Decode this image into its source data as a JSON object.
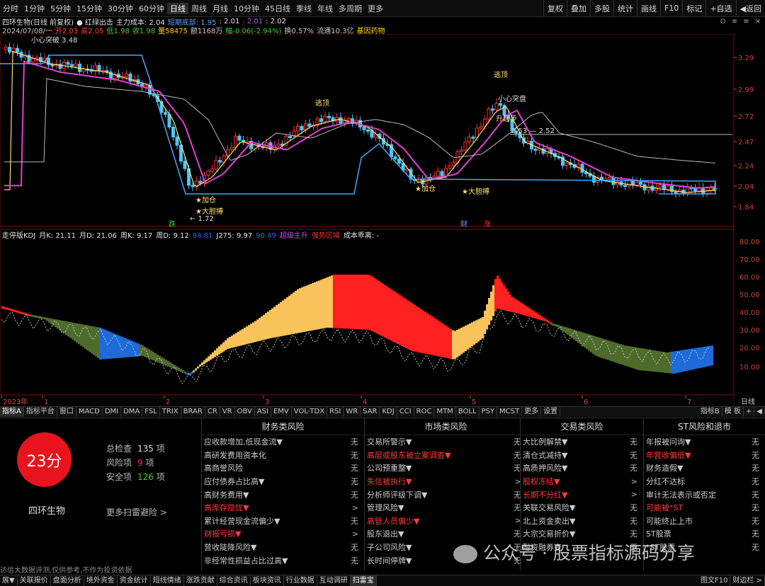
{
  "toolbar": {
    "periods": [
      "分时",
      "1分钟",
      "5分钟",
      "15分钟",
      "30分钟",
      "60分钟",
      "日线",
      "周线",
      "月线",
      "10分钟",
      "45日线",
      "季线",
      "年线",
      "多周期",
      "更多"
    ],
    "active": "日线",
    "buttons": [
      "复权",
      "叠加",
      "多股",
      "统计",
      "画线",
      "F10",
      "标记",
      "+自选",
      "◀返回"
    ]
  },
  "header": {
    "line1": [
      {
        "t": "四环生物(日线 前复权)",
        "c": "#e0e0e0"
      },
      {
        "t": "● 红绿出击",
        "c": "#e0e0e0"
      },
      {
        "t": "主力成本: 2.04",
        "c": "#e0e0e0"
      },
      {
        "t": "短期底部: 1.95",
        "c": "#5aa0ff"
      },
      {
        "t": ": 2.01",
        "c": "#e0e0e0"
      },
      {
        "t": ": 2.01",
        "c": "#c050ff"
      },
      {
        "t": ": 2.02",
        "c": "#e0e0e0"
      }
    ],
    "line2": [
      {
        "t": "2024/07/08/一",
        "c": "#c8c8c8"
      },
      {
        "t": "开2.03",
        "c": "#ff4040"
      },
      {
        "t": "高2.05",
        "c": "#ff4040"
      },
      {
        "t": "低1.98",
        "c": "#3cd03c"
      },
      {
        "t": "收1.98",
        "c": "#3cd03c"
      },
      {
        "t": "量58475",
        "c": "#ffd400"
      },
      {
        "t": "额1168万",
        "c": "#c8c8c8"
      },
      {
        "t": "幅-0.06(-2.94%)",
        "c": "#3cd03c"
      },
      {
        "t": "换0.57%",
        "c": "#c8c8c8"
      },
      {
        "t": "流通10.3亿",
        "c": "#c8c8c8"
      },
      {
        "t": "基因药物",
        "c": "#ffd400"
      }
    ],
    "winbtns": [
      "⊙",
      "≡",
      "≡",
      "×"
    ]
  },
  "main_chart": {
    "type": "candlestick",
    "yticks": [
      "3.29",
      "2.99",
      "2.72",
      "2.47",
      "2.24",
      "2.04",
      "1.84"
    ],
    "annotations": [
      "小心突破 3.48",
      "逃顶",
      "逃顶",
      "小心突盘",
      "升起步",
      "2.53 — 2.52",
      "★加仓",
      "★大胆搏",
      "← 1.72",
      "★加仓",
      "★大胆搏",
      "跌",
      "财",
      "涨"
    ]
  },
  "kdj": {
    "legend": [
      {
        "t": "走停版KDJ",
        "c": "#e0e0e0"
      },
      {
        "t": "月K: 21.11",
        "c": "#e0e0e0"
      },
      {
        "t": "月D: 21.06",
        "c": "#e0e0e0"
      },
      {
        "t": "周K: 9.17",
        "c": "#e0e0e0"
      },
      {
        "t": "周D: 9.12",
        "c": "#e0e0e0"
      },
      {
        "t": "94.81",
        "c": "#3060ff"
      },
      {
        "t": "J275: 9.97",
        "c": "#e0e0e0"
      },
      {
        "t": "90.49",
        "c": "#3060ff"
      },
      {
        "t": "超级主升",
        "c": "#d040ff"
      },
      {
        "t": "强势区域",
        "c": "#ff3030"
      },
      {
        "t": "成本乖离: -",
        "c": "#e0e0e0"
      }
    ],
    "yticks": [
      "80.00",
      "70.00",
      "60.00",
      "50.00",
      "40.00",
      "30.00",
      "20.00",
      "10.00"
    ]
  },
  "xaxis": {
    "labels": [
      "2023年",
      "1",
      "2",
      "3",
      "4",
      "5",
      "6",
      "7"
    ],
    "right": "日线"
  },
  "indicator_tabs": {
    "items": [
      "指标A",
      "指标平台",
      "窗口",
      "MACD",
      "DMI",
      "DMA",
      "FSL",
      "TRIX",
      "BRAR",
      "CR",
      "VR",
      "OBV",
      "ASI",
      "EMV",
      "VOL-TDX",
      "RSI",
      "WR",
      "SAR",
      "KDJ",
      "CCI",
      "ROC",
      "MTM",
      "BOLL",
      "PSY",
      "MCST",
      "更多",
      "设置"
    ],
    "right": [
      "指标B",
      "模 板",
      "+",
      "◀"
    ]
  },
  "risk": {
    "score": "23分",
    "stock": "四环生物",
    "total": {
      "label": "总检查",
      "value": "135",
      "unit": "项"
    },
    "risk": {
      "label": "风险项",
      "value": "9",
      "unit": "项"
    },
    "safe": {
      "label": "安全项",
      "value": "126",
      "unit": "项"
    },
    "more": "更多扫雷避险 >",
    "columns": [
      {
        "title": "财务类风险",
        "rows": [
          {
            "n": "应收款增加,低现金流▼",
            "v": "无",
            "r": false
          },
          {
            "n": "高研发费用资本化",
            "v": "无",
            "r": false
          },
          {
            "n": "高商誉风险",
            "v": "无",
            "r": false
          },
          {
            "n": "应付债券占比高▼",
            "v": "无",
            "r": false
          },
          {
            "n": "高财务费用▼",
            "v": "无",
            "r": false
          },
          {
            "n": "高库存隐忧▼",
            "v": ">",
            "r": true
          },
          {
            "n": "累计经营现金流偏少▼",
            "v": "无",
            "r": false
          },
          {
            "n": "财报亏损▼",
            "v": ">",
            "r": true
          },
          {
            "n": "营收陡降风险▼",
            "v": "无",
            "r": false
          },
          {
            "n": "非经常性损益占比过高▼",
            "v": "无",
            "r": false
          }
        ]
      },
      {
        "title": "市场类风险",
        "rows": [
          {
            "n": "交易所警示▼",
            "v": "无",
            "r": false
          },
          {
            "n": "高层或股东被立案调查▼",
            "v": "无",
            "r": true
          },
          {
            "n": "公司预重整▼",
            "v": "无",
            "r": false
          },
          {
            "n": "失信被执行▼",
            "v": ">",
            "r": true
          },
          {
            "n": "分析师评级下调▼",
            "v": "无",
            "r": false
          },
          {
            "n": "管理风险▼",
            "v": "无",
            "r": false
          },
          {
            "n": "高管人员偏少▼",
            "v": ">",
            "r": true
          },
          {
            "n": "股东退出▼",
            "v": "无",
            "r": false
          },
          {
            "n": "子公司风险▼",
            "v": "无",
            "r": false
          },
          {
            "n": "长时间停牌▼",
            "v": "无",
            "r": false
          }
        ]
      },
      {
        "title": "交易类风险",
        "rows": [
          {
            "n": "大比例解禁▼",
            "v": "无",
            "r": false
          },
          {
            "n": "清仓式减持▼",
            "v": "无",
            "r": false
          },
          {
            "n": "高质押风险▼",
            "v": "无",
            "r": false
          },
          {
            "n": "股权冻结▼",
            "v": ">",
            "r": true
          },
          {
            "n": "长期不分红▼",
            "v": ">",
            "r": true
          },
          {
            "n": "关联交易风险▼",
            "v": "无",
            "r": false
          },
          {
            "n": "北上资金卖出▼",
            "v": "无",
            "r": false
          },
          {
            "n": "大宗交易折价▼",
            "v": "无",
            "r": false
          },
          {
            "n": "融资融券变",
            "v": "无",
            "r": false
          },
          {
            "n": "",
            "v": "",
            "r": false
          }
        ]
      },
      {
        "title": "ST风险和退市",
        "rows": [
          {
            "n": "年报被问询▼",
            "v": "无",
            "r": false
          },
          {
            "n": "年营收偏低▼",
            "v": "无",
            "r": true
          },
          {
            "n": "财务造假▼",
            "v": "无",
            "r": false
          },
          {
            "n": "分红不达标",
            "v": "无",
            "r": false
          },
          {
            "n": "审计无法表示或否定",
            "v": "无",
            "r": false
          },
          {
            "n": "可能被*ST",
            "v": "无",
            "r": true
          },
          {
            "n": "可能终止上市",
            "v": "无",
            "r": false
          },
          {
            "n": "ST股票",
            "v": "无",
            "r": false
          },
          {
            "n": "*ST股票",
            "v": "无",
            "r": false
          },
          {
            "n": "",
            "v": "",
            "r": false
          }
        ]
      }
    ],
    "disclaimer": "达信大数据评测,仅供参考,不作为投资依据"
  },
  "watermark": "公众号 · 股票指标源码分享",
  "bottom": {
    "items": [
      "展▼",
      "关联报价",
      "盘面分析",
      "境外资金",
      "资金统计",
      "短线情绪",
      "涨跌贡献",
      "综合资讯",
      "板块资讯",
      "行业数据",
      "互动调研",
      "扫雷宝"
    ],
    "active": "扫雷宝",
    "right": [
      "图文F10",
      "财边栏 >"
    ]
  },
  "colors": {
    "up": "#ff3030",
    "down": "#4fc3f7",
    "ma_yellow": "#ffe066",
    "ma_magenta": "#e040d0",
    "ma_white": "#cccccc",
    "support": "#3fa9f5"
  }
}
